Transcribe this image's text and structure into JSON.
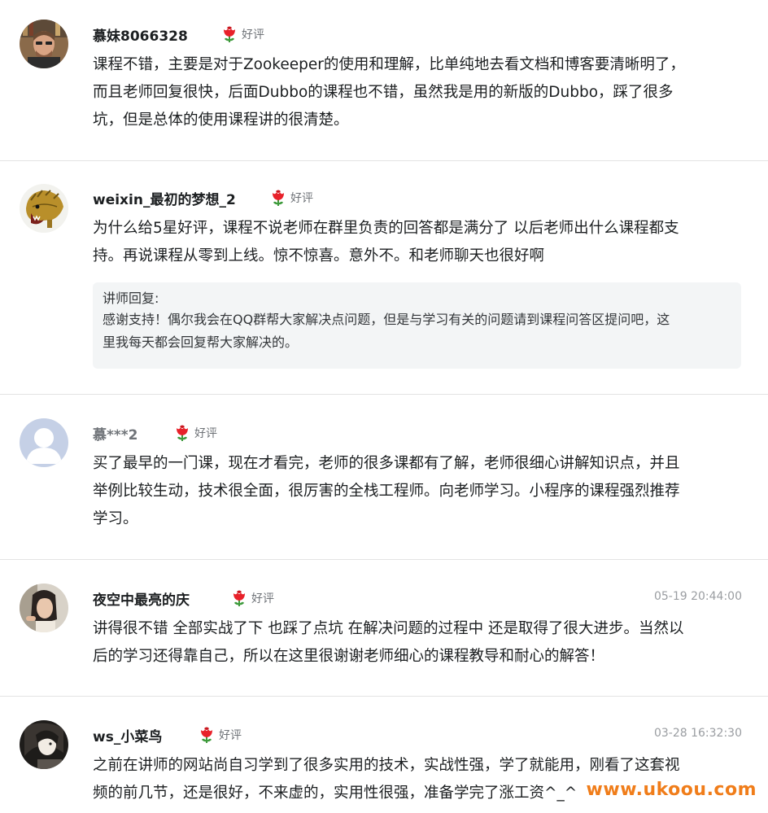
{
  "reviews": [
    {
      "user": "慕妹8066328",
      "rating_label": "好评",
      "time": "",
      "content_lines": [
        "课程不错，主要是对于Zookeeper的使用和理解，比单纯地去看文档和博客要清晰明了，",
        "而且老师回复很快，后面Dubbo的课程也不错，虽然我是用的新版的Dubbo，踩了很多",
        "坑，但是总体的使用课程讲的很清楚。"
      ]
    },
    {
      "user": "weixin_最初的梦想_2",
      "rating_label": "好评",
      "time": "",
      "content_lines": [
        "为什么给5星好评，课程不说老师在群里负责的回答都是满分了 以后老师出什么课程都支",
        "持。再说课程从零到上线。惊不惊喜。意外不。和老师聊天也很好啊"
      ],
      "reply": {
        "title": "讲师回复:",
        "lines": [
          "感谢支持！偶尔我会在QQ群帮大家解决点问题，但是与学习有关的问题请到课程问答区提问吧，这",
          "里我每天都会回复帮大家解决的。"
        ]
      }
    },
    {
      "user": "慕***2",
      "rating_label": "好评",
      "time": "",
      "content_lines": [
        "买了最早的一门课，现在才看完，老师的很多课都有了解，老师很细心讲解知识点，并且",
        "举例比较生动，技术很全面，很厉害的全栈工程师。向老师学习。小程序的课程强烈推荐",
        "学习。"
      ]
    },
    {
      "user": "夜空中最亮的庆",
      "rating_label": "好评",
      "time": "05-19 20:44:00",
      "content_lines": [
        "讲得很不错 全部实战了下 也踩了点坑 在解决问题的过程中 还是取得了很大进步。当然以",
        "后的学习还得靠自己，所以在这里很谢谢老师细心的课程教导和耐心的解答！"
      ]
    },
    {
      "user": "ws_小菜鸟",
      "rating_label": "好评",
      "time": "03-28 16:32:30",
      "content_lines": [
        "之前在讲师的网站尚自习学到了很多实用的技术，实战性强，学了就能用，刚看了这套视",
        "频的前几节，还是很好，不来虚的，实用性很强，准备学完了涨工资^_^"
      ]
    }
  ],
  "watermark": "www.ukoou.com",
  "colors": {
    "text": "#1c1f21",
    "muted": "#6f7378",
    "time": "#9a9da1",
    "divider": "#e3e3e3",
    "reply_bg": "#f3f5f6",
    "flower": "#e8212a",
    "watermark": "#f07d1a"
  }
}
